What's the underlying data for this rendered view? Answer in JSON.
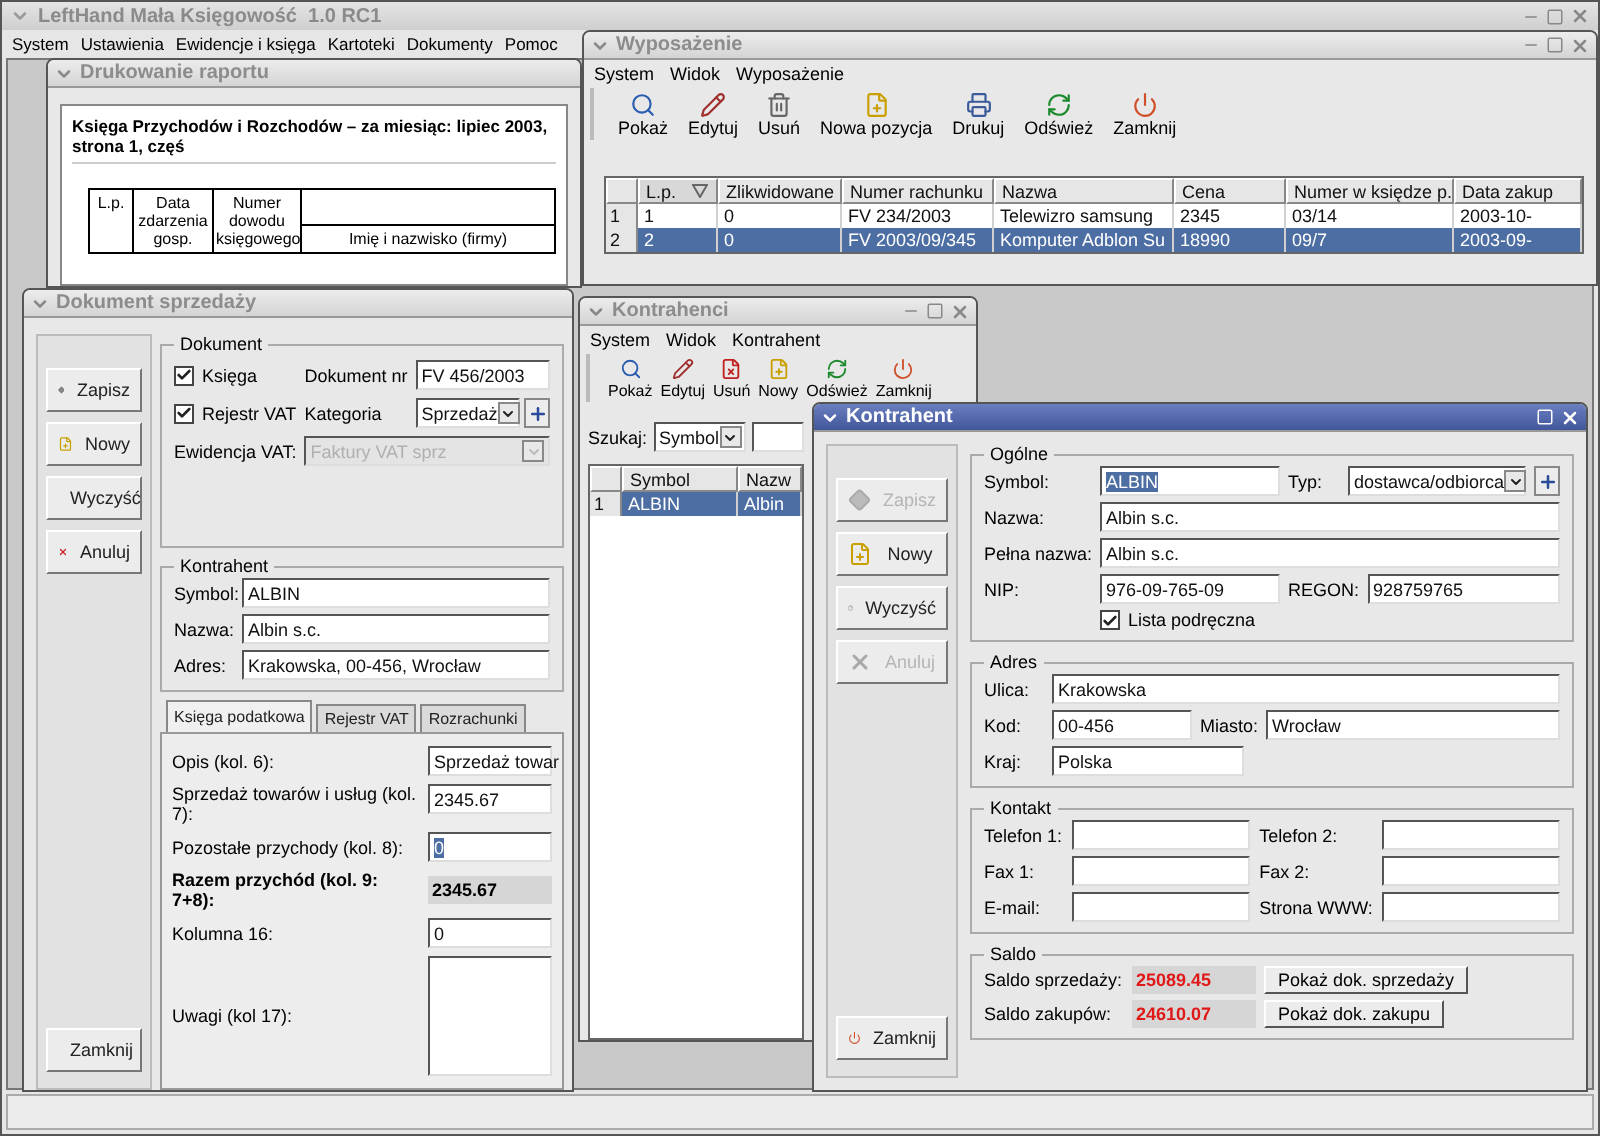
{
  "app": {
    "title": "LeftHand Mała Księgowość  1.0 RC1",
    "menu": [
      "System",
      "Ustawienia",
      "Ewidencje i księga",
      "Kartoteki",
      "Dokumenty",
      "Pomoc"
    ]
  },
  "report_window": {
    "title": "Drukowanie raportu",
    "active": false,
    "heading": "Księga Przychodów i Rozchodów – za miesiąc: lipiec 2003, strona 1, częś",
    "columns": [
      "L.p.",
      "Data zdarzenia gosp.",
      "Numer dowodu księgowego",
      "Imię i nazwisko (firmy)"
    ]
  },
  "equipment_window": {
    "title": "Wyposażenie",
    "active": false,
    "menu": [
      "System",
      "Widok",
      "Wyposażenie"
    ],
    "toolbar": [
      {
        "label": "Pokaż",
        "kind": "search"
      },
      {
        "label": "Edytuj",
        "kind": "edit"
      },
      {
        "label": "Usuń",
        "kind": "delete"
      },
      {
        "label": "Nowa pozycja",
        "kind": "new"
      },
      {
        "label": "Drukuj",
        "kind": "print"
      },
      {
        "label": "Odśwież",
        "kind": "refresh"
      },
      {
        "label": "Zamknij",
        "kind": "close"
      }
    ],
    "table": {
      "columns": [
        {
          "label": "L.p.",
          "sorted": true
        },
        {
          "label": "Zlikwidowane",
          "sorted": false
        },
        {
          "label": "Numer rachunku",
          "sorted": false
        },
        {
          "label": "Nazwa",
          "sorted": false
        },
        {
          "label": "Cena",
          "sorted": false
        },
        {
          "label": "Numer w księdze p.",
          "sorted": false
        },
        {
          "label": "Data zakup",
          "sorted": false
        }
      ],
      "rows": [
        {
          "number": "1",
          "selected": false,
          "cells": [
            "1",
            "0",
            "FV 234/2003",
            "Telewizro samsung",
            "2345",
            "03/14",
            "2003-10-"
          ]
        },
        {
          "number": "2",
          "selected": true,
          "cells": [
            "2",
            "0",
            "FV 2003/09/345",
            "Komputer Adblon Su",
            "18990",
            "09/7",
            "2003-09-"
          ]
        }
      ]
    }
  },
  "sales_window": {
    "title": "Dokument sprzedaży",
    "active": false,
    "buttons": [
      {
        "label": "Zapisz",
        "kind": "save",
        "disabled": false
      },
      {
        "label": "Nowy",
        "kind": "new",
        "disabled": false
      },
      {
        "label": "Wyczyść",
        "kind": "clear",
        "disabled": false
      },
      {
        "label": "Anuluj",
        "kind": "cancel",
        "disabled": false
      }
    ],
    "close_button": {
      "label": "Zamknij",
      "kind": "close"
    },
    "document_group": {
      "legend": "Dokument",
      "ledger": {
        "label": "Księga",
        "checked": true
      },
      "number_label": "Dokument nr",
      "number": "FV 456/2003",
      "vat": {
        "label": "Rejestr VAT",
        "checked": true
      },
      "category_label": "Kategoria",
      "category": "Sprzedaż",
      "register_label": "Ewidencja VAT:",
      "register": "Faktury VAT sprz",
      "register_disabled": true
    },
    "contractor_group": {
      "legend": "Kontrahent",
      "fields": [
        {
          "label": "Symbol:",
          "value": "ALBIN"
        },
        {
          "label": "Nazwa:",
          "value": "Albin s.c."
        },
        {
          "label": "Adres:",
          "value": "Krakowska, 00-456, Wrocław"
        }
      ]
    },
    "tabs": [
      {
        "label": "Księga podatkowa",
        "selected": true
      },
      {
        "label": "Rejestr VAT",
        "selected": false
      },
      {
        "label": "Rozrachunki",
        "selected": false
      }
    ],
    "ledger_fields": [
      {
        "kind": "input",
        "label": "Opis (kol. 6):",
        "value": "Sprzedaż towar",
        "highlighted": false
      },
      {
        "kind": "input",
        "label": "Sprzedaż towarów i usług (kol. 7):",
        "value": "2345.67",
        "highlighted": false
      },
      {
        "kind": "input",
        "label": "Pozostałe przychody (kol. 8):",
        "value": "0",
        "highlighted": true
      },
      {
        "kind": "total",
        "label": "Razem przychód (kol. 9: 7+8):",
        "value": "2345.67"
      },
      {
        "kind": "input",
        "label": "Kolumna 16:",
        "value": "0",
        "highlighted": false
      },
      {
        "kind": "textarea",
        "label": "Uwagi (kol 17):"
      }
    ]
  },
  "contractors_window": {
    "title": "Kontrahenci",
    "active": false,
    "menu": [
      "System",
      "Widok",
      "Kontrahent"
    ],
    "toolbar": [
      {
        "label": "Pokaż",
        "kind": "search"
      },
      {
        "label": "Edytuj",
        "kind": "edit"
      },
      {
        "label": "Usuń",
        "kind": "remove"
      },
      {
        "label": "Nowy",
        "kind": "new"
      },
      {
        "label": "Odśwież",
        "kind": "refresh"
      },
      {
        "label": "Zamknij",
        "kind": "close"
      }
    ],
    "search_label": "Szukaj:",
    "search_by": "Symbol",
    "table": {
      "columns": [
        "Symbol",
        "Nazw"
      ],
      "rows": [
        {
          "number": "1",
          "selected": true,
          "cells": [
            "ALBIN",
            "Albin"
          ]
        }
      ]
    }
  },
  "contractor_dialog": {
    "title": "Kontrahent",
    "active": true,
    "buttons": [
      {
        "label": "Zapisz",
        "kind": "save",
        "disabled": true
      },
      {
        "label": "Nowy",
        "kind": "new",
        "disabled": false
      },
      {
        "label": "Wyczyść",
        "kind": "clear",
        "disabled": false
      },
      {
        "label": "Anuluj",
        "kind": "cancel",
        "disabled": true
      }
    ],
    "close_button": {
      "label": "Zamknij",
      "kind": "close"
    },
    "general": {
      "legend": "Ogólne",
      "symbol_label": "Symbol:",
      "symbol": "ALBIN",
      "symbol_highlighted": true,
      "type_label": "Typ:",
      "type": "dostawca/odbiorca",
      "name_label": "Nazwa:",
      "name": "Albin s.c.",
      "full_name_label": "Pełna nazwa:",
      "full_name": "Albin s.c.",
      "nip_label": "NIP:",
      "nip": "976-09-765-09",
      "regon_label": "REGON:",
      "regon": "928759765",
      "quick_list": {
        "label": "Lista podręczna",
        "checked": true
      }
    },
    "address": {
      "legend": "Adres",
      "street_label": "Ulica:",
      "street": "Krakowska",
      "postcode_label": "Kod:",
      "postcode": "00-456",
      "city_label": "Miasto:",
      "city": "Wrocław",
      "country_label": "Kraj:",
      "country": "Polska"
    },
    "contact": {
      "legend": "Kontakt",
      "fields": [
        {
          "label": "Telefon 1:"
        },
        {
          "label": "Telefon 2:"
        },
        {
          "label": "Fax 1:"
        },
        {
          "label": "Fax 2:"
        },
        {
          "label": "E-mail:"
        },
        {
          "label": "Strona WWW:"
        }
      ]
    },
    "balance": {
      "legend": "Saldo",
      "rows": [
        {
          "label": "Saldo sprzedaży:",
          "value": "25089.45",
          "button": "Pokaż dok. sprzedaży"
        },
        {
          "label": "Saldo zakupów:",
          "value": "24610.07",
          "button": "Pokaż dok. zakupu"
        }
      ]
    }
  }
}
